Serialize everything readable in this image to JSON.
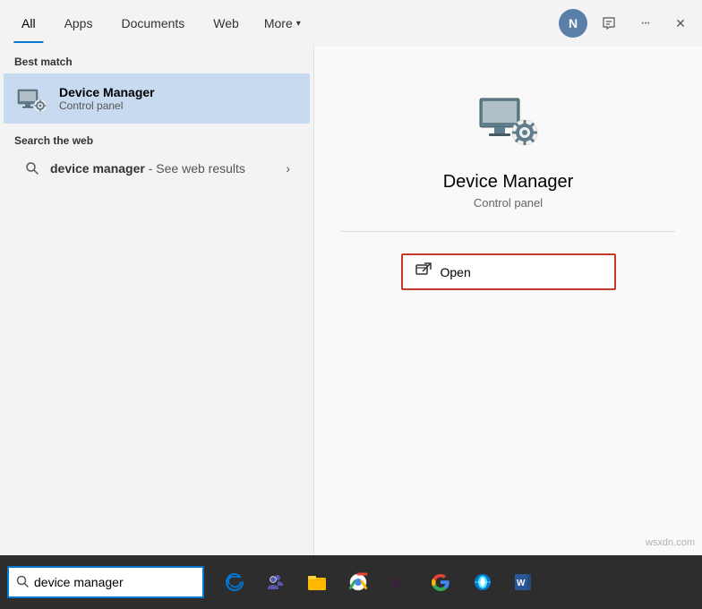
{
  "nav": {
    "tabs": [
      {
        "id": "all",
        "label": "All",
        "active": true
      },
      {
        "id": "apps",
        "label": "Apps",
        "active": false
      },
      {
        "id": "documents",
        "label": "Documents",
        "active": false
      },
      {
        "id": "web",
        "label": "Web",
        "active": false
      },
      {
        "id": "more",
        "label": "More",
        "active": false
      }
    ],
    "avatar_letter": "N",
    "dots_icon": "···",
    "close_icon": "✕"
  },
  "left": {
    "best_match_label": "Best match",
    "best_match_title": "Device Manager",
    "best_match_subtitle": "Control panel",
    "search_web_label": "Search the web",
    "web_search_query": "device manager",
    "web_search_suffix": " - See web results"
  },
  "right": {
    "app_name": "Device Manager",
    "app_type": "Control panel",
    "separator": true,
    "action_label": "Open"
  },
  "taskbar": {
    "search_placeholder": "",
    "search_value": "device manager",
    "icons": [
      {
        "name": "edge",
        "symbol": "🌐",
        "color": "#0078d4"
      },
      {
        "name": "teams",
        "symbol": "👥",
        "color": "#5558af"
      },
      {
        "name": "file-explorer",
        "symbol": "📁",
        "color": "#ffb900"
      },
      {
        "name": "chrome",
        "symbol": "⬤",
        "color": "#4285f4"
      },
      {
        "name": "slack",
        "symbol": "#",
        "color": "#4a154b"
      },
      {
        "name": "google",
        "symbol": "G",
        "color": "#4285f4"
      },
      {
        "name": "mail",
        "symbol": "✉",
        "color": "#0078d4"
      },
      {
        "name": "word",
        "symbol": "W",
        "color": "#2b579a"
      }
    ]
  },
  "watermark": "wsxdn.com"
}
